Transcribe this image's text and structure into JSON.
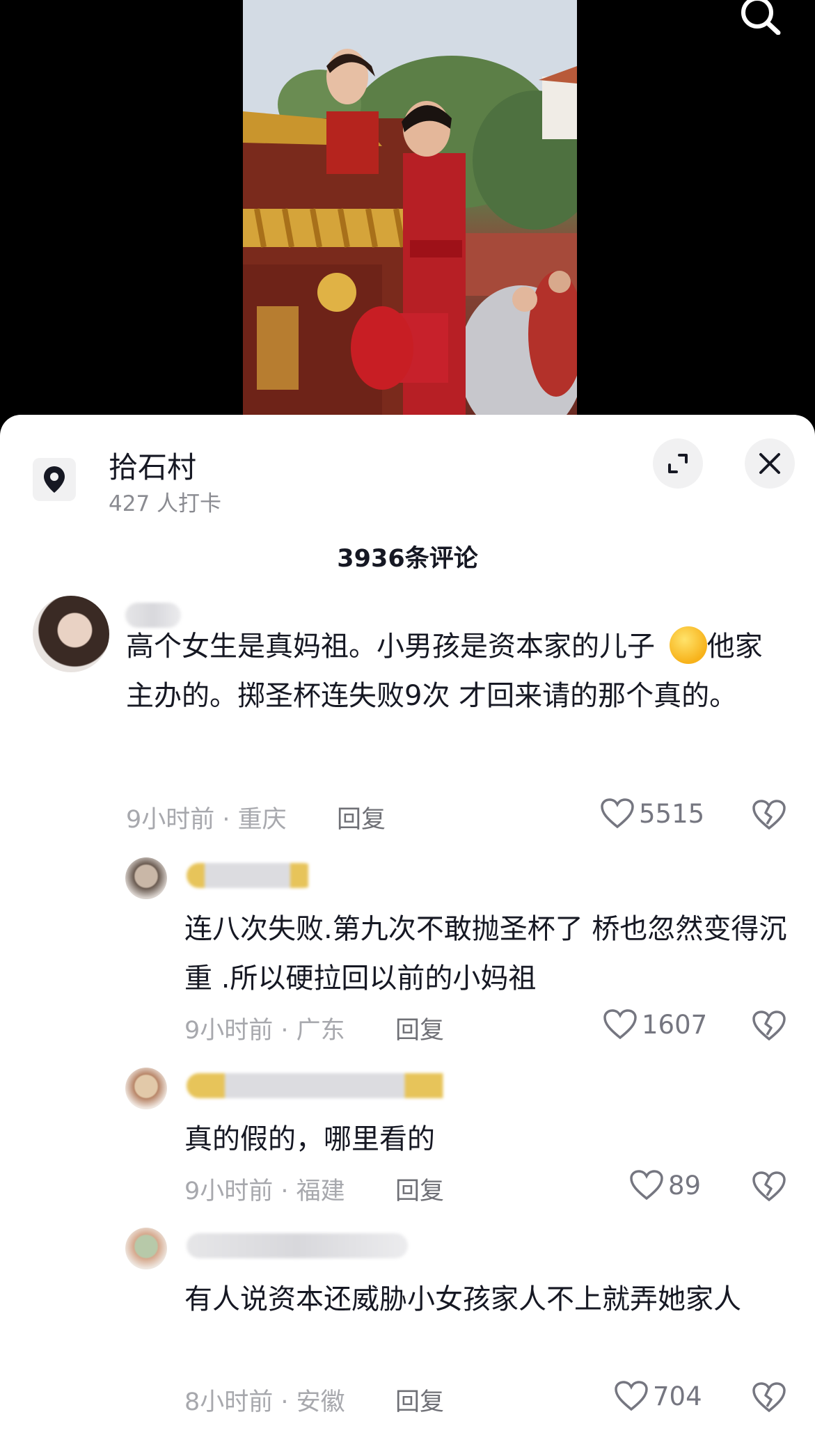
{
  "location": {
    "name": "拾石村",
    "checkins": "427 人打卡"
  },
  "comments_header": {
    "count_label": "3936条评论"
  },
  "icons": {
    "search": "search-icon",
    "location": "location-pin-icon",
    "expand": "expand-icon",
    "close": "close-icon",
    "like": "heart-icon",
    "dislike": "broken-heart-icon"
  },
  "comments": [
    {
      "text_a": "高个女生是真妈祖。小男孩是资本家的儿子 ",
      "text_b": "他家主办的。掷圣杯连失败9次 才回来请的那个真的。",
      "emoji": "smirk-face-emoji",
      "meta": "9小时前 · 重庆",
      "reply": "回复",
      "likes": "5515"
    },
    {
      "text": "连八次失败.第九次不敢抛圣杯了 桥也忽然变得沉重 .所以硬拉回以前的小妈祖",
      "meta": "9小时前 · 广东",
      "reply": "回复",
      "likes": "1607"
    },
    {
      "text": "真的假的，哪里看的",
      "meta": "9小时前 · 福建",
      "reply": "回复",
      "likes": "89"
    },
    {
      "text": "有人说资本还威胁小女孩家人不上就弄她家人",
      "meta": "8小时前 · 安徽",
      "reply": "回复",
      "likes": "704"
    }
  ],
  "colors": {
    "sheet_bg": "#ffffff",
    "text_primary": "#161823",
    "text_secondary": "#a7a8ad",
    "button_bg": "#f1f1f2"
  }
}
